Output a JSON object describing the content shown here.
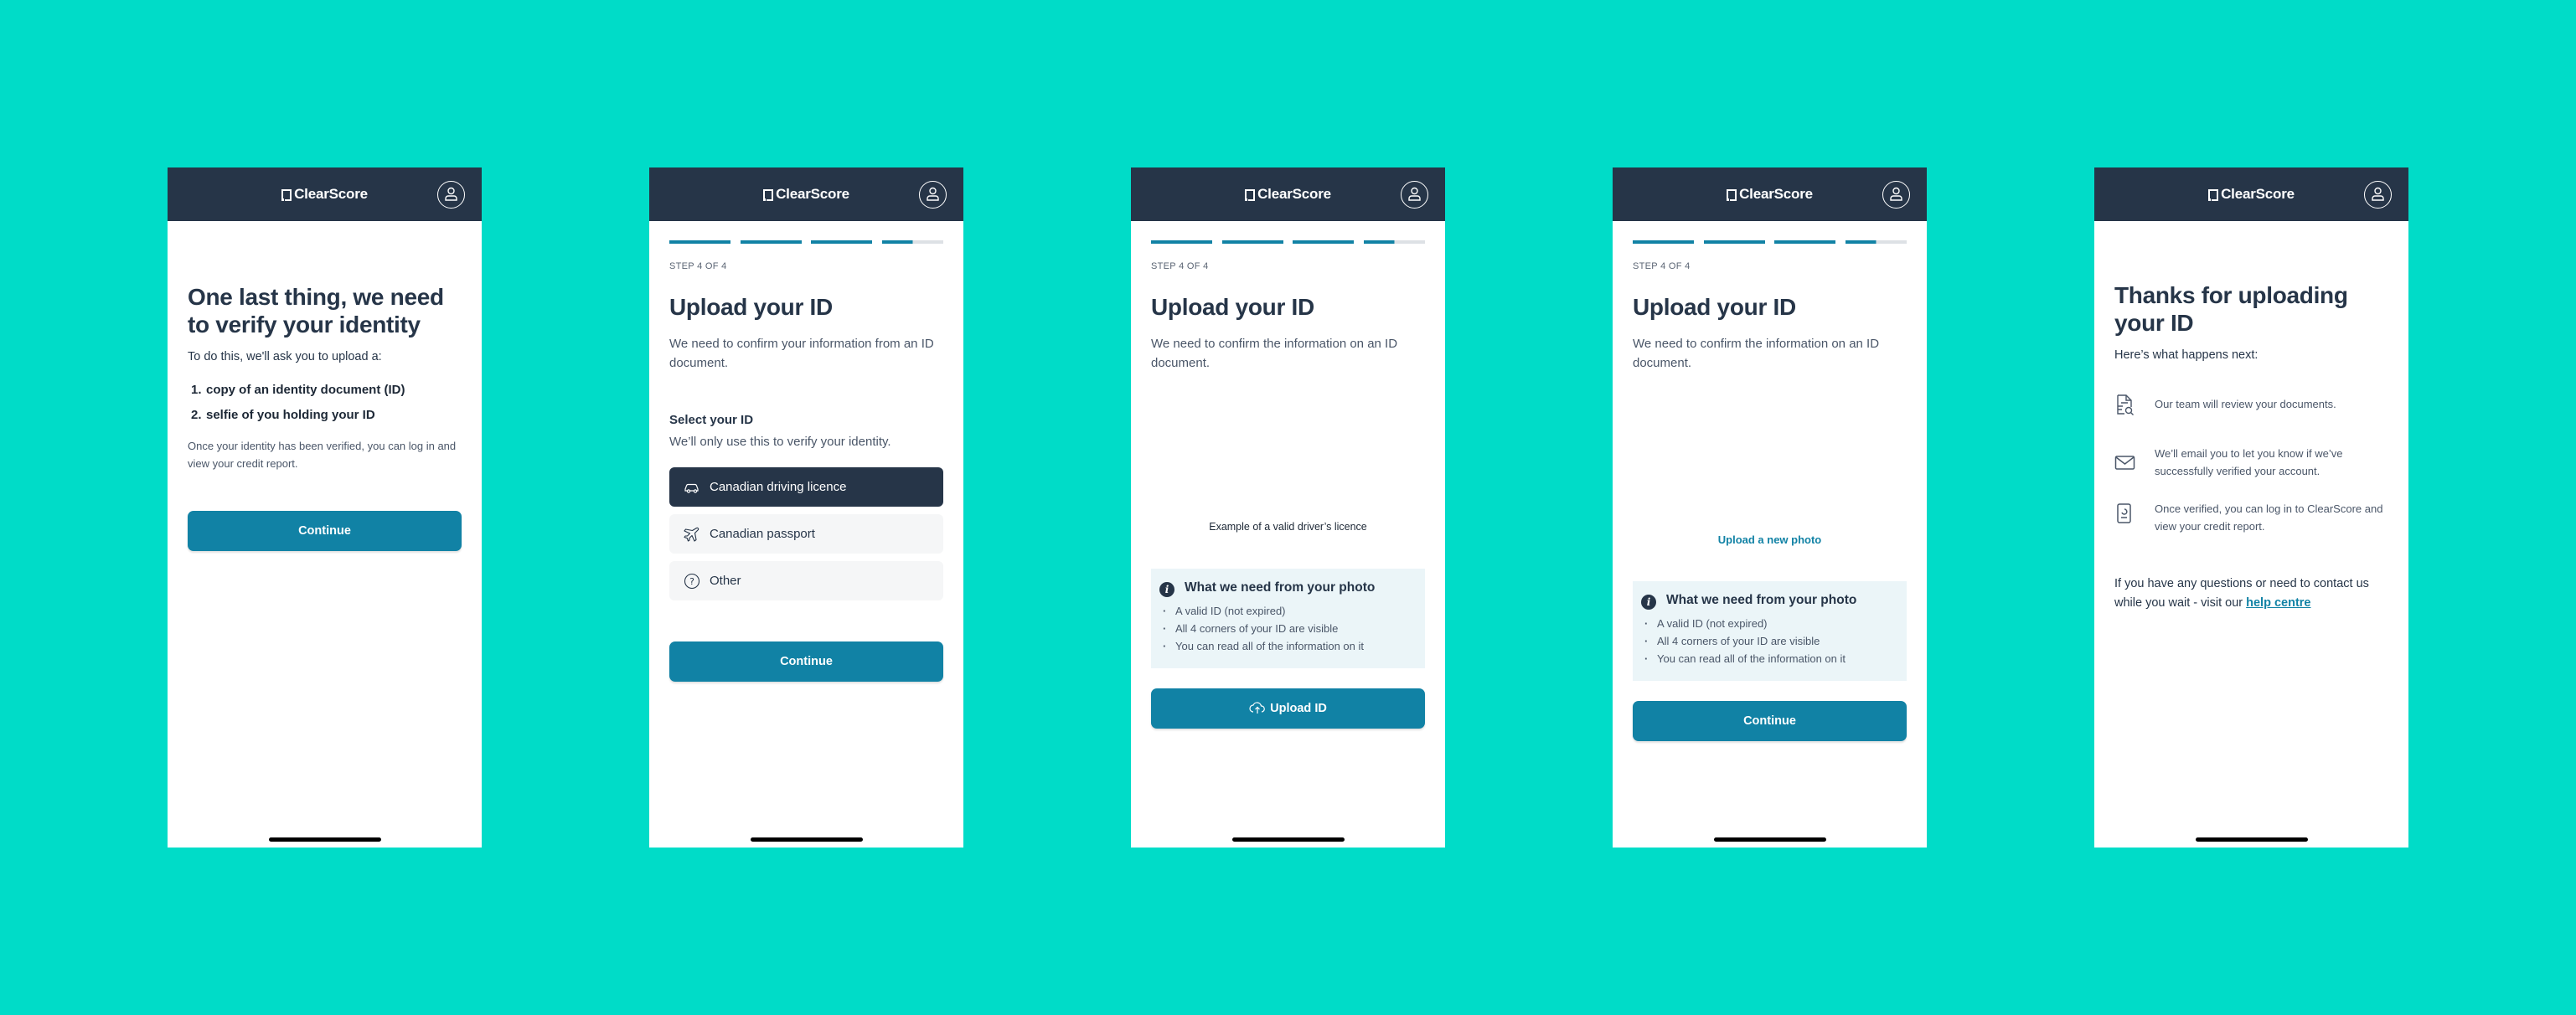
{
  "brand": {
    "name": "ClearScore",
    "background": "#00dcc8",
    "header_color": "#263548",
    "accent": "#1182a5"
  },
  "screen1": {
    "title": "One last thing, we need to verify your identity",
    "intro": "To do this, we'll ask you to upload a:",
    "list": [
      {
        "num": "1.",
        "text": "copy of an identity document (ID)"
      },
      {
        "num": "2.",
        "text": "selfie of you holding your ID"
      }
    ],
    "note": "Once  your identity has been verified, you can log in and view your credit report.",
    "button": "Continue"
  },
  "screen2": {
    "step": "STEP 4 OF 4",
    "progress": {
      "segments_total": 4,
      "segments_complete": 3,
      "current_segment_fraction": 0.5
    },
    "title": "Upload your ID",
    "description": "We need to confirm your information from an ID document.",
    "select_label": "Select your ID",
    "select_hint": "We’ll only use this to verify your identity.",
    "options": [
      {
        "label": "Canadian driving licence",
        "icon": "car-icon",
        "selected": true
      },
      {
        "label": "Canadian passport",
        "icon": "plane-icon",
        "selected": false
      },
      {
        "label": "Other",
        "icon": "question-circle-icon",
        "selected": false
      }
    ],
    "button": "Continue"
  },
  "screen3": {
    "step": "STEP 4 OF 4",
    "title": "Upload your ID",
    "description": "We need to confirm the information on an ID document.",
    "caption": "Example of a valid driver’s licence",
    "info_title": "What we need from your photo",
    "info_items": [
      "A valid ID (not expired)",
      "All 4 corners of your ID are visible",
      "You can read all of the information on it"
    ],
    "button": "Upload ID"
  },
  "screen4": {
    "step": "STEP 4 OF 4",
    "title": "Upload your ID",
    "description": "We need to confirm the information on an ID document.",
    "link": "Upload a new photo",
    "info_title": "What we need from your photo",
    "info_items": [
      "A valid ID (not expired)",
      "All 4 corners of your ID are visible",
      "You can read all of the information on it"
    ],
    "button": "Continue"
  },
  "screen5": {
    "title": "Thanks for uploading your ID",
    "intro": "Here’s what happens next:",
    "items": [
      {
        "icon": "document-search-icon",
        "text": "Our team will review your documents."
      },
      {
        "icon": "envelope-icon",
        "text": "We’ll email you to let you know if we’ve successfully verified your account."
      },
      {
        "icon": "credit-report-icon",
        "text": "Once verified, you can log in to ClearScore and view your credit report."
      }
    ],
    "help_prefix": "If you have any questions or need to contact us while you wait - visit our ",
    "help_link": "help centre"
  }
}
